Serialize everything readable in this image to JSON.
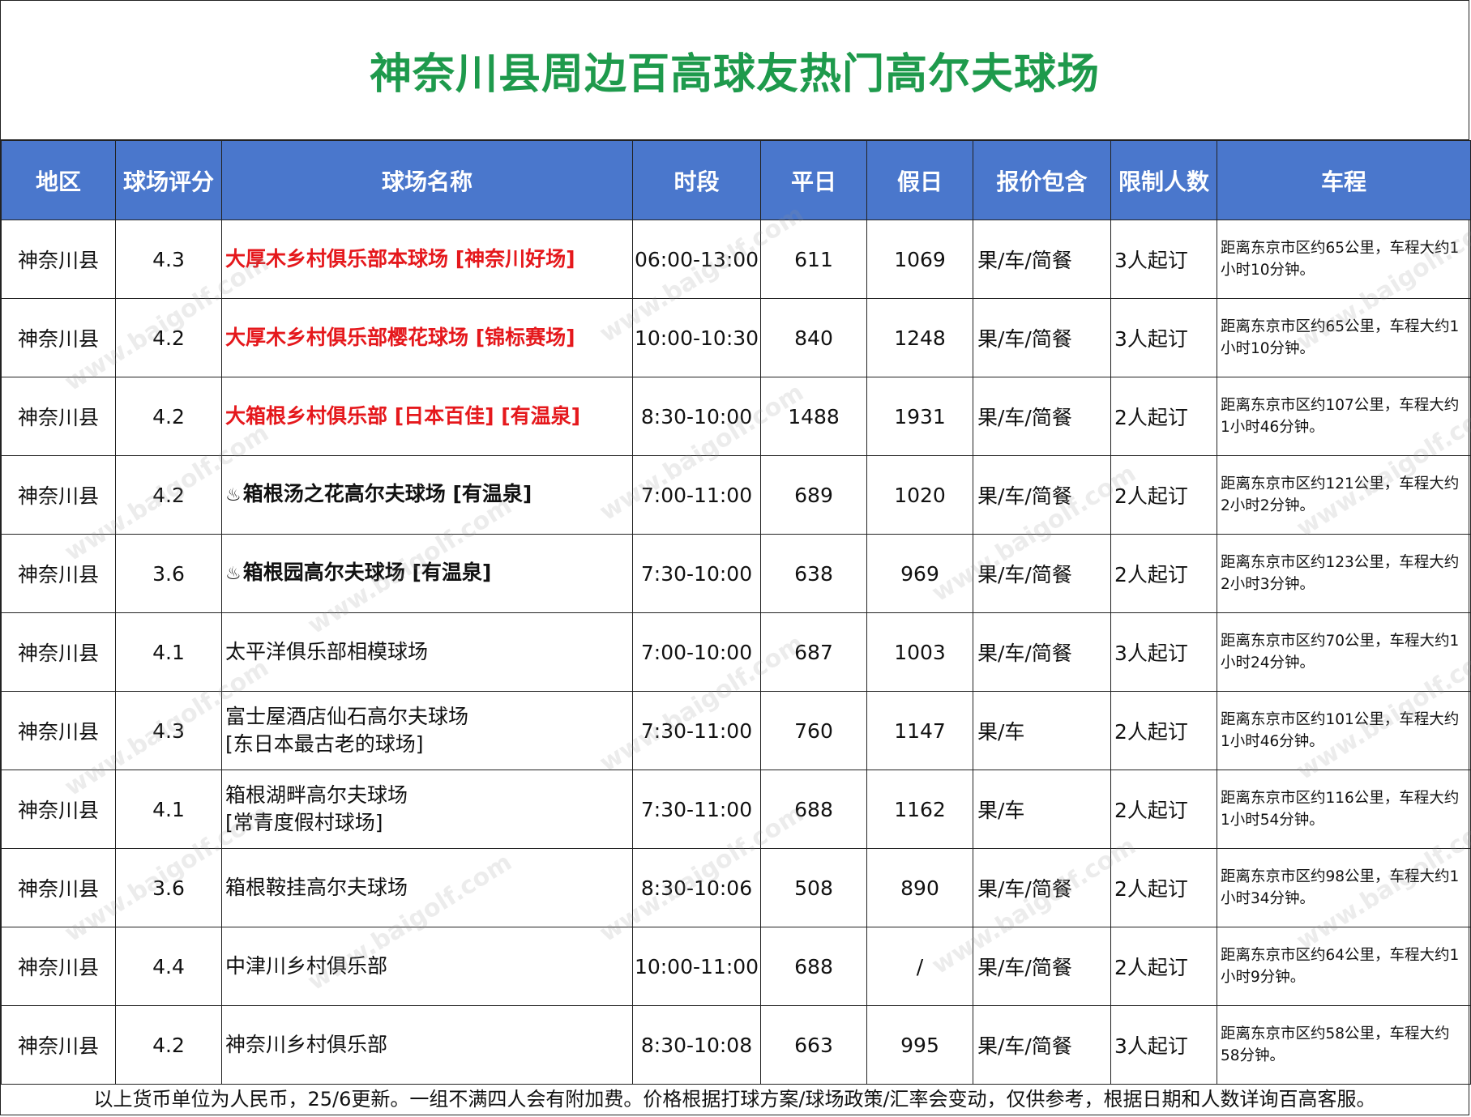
{
  "title": "神奈川县周边百高球友热门高尔夫球场",
  "headers": [
    "地区",
    "球场评分",
    "球场名称",
    "时段",
    "平日",
    "假日",
    "报价包含",
    "限制人数",
    "车程"
  ],
  "rows": [
    {
      "region": "神奈川县",
      "rating": "4.3",
      "name_line1": "大厚木乡村俱乐部本球场 [神奈川好场]",
      "name_line2": "",
      "style": "red",
      "hot_spring_icon": false,
      "time": "06:00-13:00",
      "weekday": "611",
      "holiday": "1069",
      "includes": "果/车/简餐",
      "min_players": "3人起订",
      "drive_line1": "距离东京市区约65公里，车程大约1",
      "drive_line2": "小时10分钟。"
    },
    {
      "region": "神奈川县",
      "rating": "4.2",
      "name_line1": "大厚木乡村俱乐部樱花球场 [锦标赛场]",
      "name_line2": "",
      "style": "red",
      "hot_spring_icon": false,
      "time": "10:00-10:30",
      "weekday": "840",
      "holiday": "1248",
      "includes": "果/车/简餐",
      "min_players": "3人起订",
      "drive_line1": "距离东京市区约65公里，车程大约1",
      "drive_line2": "小时10分钟。"
    },
    {
      "region": "神奈川县",
      "rating": "4.2",
      "name_line1": "大箱根乡村俱乐部 [日本百佳] [有温泉]",
      "name_line2": "",
      "style": "red",
      "hot_spring_icon": false,
      "time": "8:30-10:00",
      "weekday": "1488",
      "holiday": "1931",
      "includes": "果/车/简餐",
      "min_players": "2人起订",
      "drive_line1": "距离东京市区约107公里，车程大约",
      "drive_line2": "1小时46分钟。"
    },
    {
      "region": "神奈川县",
      "rating": "4.2",
      "name_line1": "箱根汤之花高尔夫球场 [有温泉]",
      "name_line2": "",
      "style": "bold",
      "hot_spring_icon": true,
      "time": "7:00-11:00",
      "weekday": "689",
      "holiday": "1020",
      "includes": "果/车/简餐",
      "min_players": "2人起订",
      "drive_line1": "距离东京市区约121公里，车程大约",
      "drive_line2": "2小时2分钟。"
    },
    {
      "region": "神奈川县",
      "rating": "3.6",
      "name_line1": "箱根园高尔夫球场 [有温泉]",
      "name_line2": "",
      "style": "bold",
      "hot_spring_icon": true,
      "time": "7:30-10:00",
      "weekday": "638",
      "holiday": "969",
      "includes": "果/车/简餐",
      "min_players": "2人起订",
      "drive_line1": "距离东京市区约123公里，车程大约",
      "drive_line2": "2小时3分钟。"
    },
    {
      "region": "神奈川县",
      "rating": "4.1",
      "name_line1": "太平洋俱乐部相模球场",
      "name_line2": "",
      "style": "normal",
      "hot_spring_icon": false,
      "time": "7:00-10:00",
      "weekday": "687",
      "holiday": "1003",
      "includes": "果/车/简餐",
      "min_players": "3人起订",
      "drive_line1": "距离东京市区约70公里，车程大约1",
      "drive_line2": "小时24分钟。"
    },
    {
      "region": "神奈川县",
      "rating": "4.3",
      "name_line1": "富士屋酒店仙石高尔夫球场",
      "name_line2": "[东日本最古老的球场]",
      "style": "normal",
      "hot_spring_icon": false,
      "time": "7:30-11:00",
      "weekday": "760",
      "holiday": "1147",
      "includes": "果/车",
      "min_players": "2人起订",
      "drive_line1": "距离东京市区约101公里，车程大约",
      "drive_line2": "1小时46分钟。"
    },
    {
      "region": "神奈川县",
      "rating": "4.1",
      "name_line1": "箱根湖畔高尔夫球场",
      "name_line2": "[常青度假村球场]",
      "style": "normal",
      "hot_spring_icon": false,
      "time": "7:30-11:00",
      "weekday": "688",
      "holiday": "1162",
      "includes": "果/车",
      "min_players": "2人起订",
      "drive_line1": "距离东京市区约116公里，车程大约",
      "drive_line2": "1小时54分钟。"
    },
    {
      "region": "神奈川县",
      "rating": "3.6",
      "name_line1": "箱根鞍挂高尔夫球场",
      "name_line2": "",
      "style": "normal",
      "hot_spring_icon": false,
      "time": "8:30-10:06",
      "weekday": "508",
      "holiday": "890",
      "includes": "果/车/简餐",
      "min_players": "2人起订",
      "drive_line1": "距离东京市区约98公里，车程大约1",
      "drive_line2": "小时34分钟。"
    },
    {
      "region": "神奈川县",
      "rating": "4.4",
      "name_line1": "中津川乡村俱乐部",
      "name_line2": "",
      "style": "normal",
      "hot_spring_icon": false,
      "time": "10:00-11:00",
      "weekday": "688",
      "holiday": "/",
      "includes": "果/车/简餐",
      "min_players": "2人起订",
      "drive_line1": "距离东京市区约64公里，车程大约1",
      "drive_line2": "小时9分钟。"
    },
    {
      "region": "神奈川县",
      "rating": "4.2",
      "name_line1": "神奈川乡村俱乐部",
      "name_line2": "",
      "style": "normal",
      "hot_spring_icon": false,
      "time": "8:30-10:08",
      "weekday": "663",
      "holiday": "995",
      "includes": "果/车/简餐",
      "min_players": "3人起订",
      "drive_line1": "距离东京市区约58公里，车程大约",
      "drive_line2": "58分钟。"
    }
  ],
  "hot_spring_glyph": "♨",
  "footer": "以上货币单位为人民币，25/6更新。一组不满四人会有附加费。价格根据打球方案/球场政策/汇率会变动，仅供参考，根据日期和人数详询百高客服。",
  "watermark": "www.baigolf.com",
  "colors": {
    "title": "#1e9a4c",
    "header_bg": "#4a77cc",
    "highlight_red": "#e5181c"
  }
}
